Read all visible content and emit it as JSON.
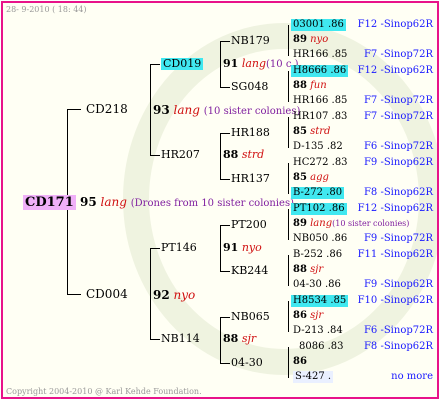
{
  "header": {
    "timestamp": "28-  9-2010 ( 18: 44)"
  },
  "footer": {
    "copyright": "Copyright 2004-2010 @ Karl Kehde Foundation."
  },
  "root": {
    "id": "CD171",
    "num": "95",
    "lang": "lang",
    "note": "(Drones from 10 sister colonies)"
  },
  "gen1": [
    {
      "id": "CD218",
      "num": "93",
      "lang": "lang",
      "note": "(10 sister colonies)"
    },
    {
      "id": "CD004",
      "num": "92",
      "lang": "nyo"
    }
  ],
  "gen2": [
    {
      "id": "CD019",
      "num": "91",
      "lang": "lang",
      "note": "(10 c.)"
    },
    {
      "id": "HR207",
      "num": "88",
      "lang": "strd"
    },
    {
      "id": "PT146",
      "num": "91",
      "lang": "nyo"
    },
    {
      "id": "NB114",
      "num": "88",
      "lang": "sjr"
    }
  ],
  "gen3": [
    "NB179",
    "SG048",
    "HR188",
    "HR137",
    "PT200",
    "KB244",
    "NB065",
    "04-30"
  ],
  "gen4": [
    {
      "id": "03001 .86",
      "num": "89",
      "lang": "nyo",
      "dam": "HR166 .85"
    },
    {
      "id": "H8666 .86",
      "num": "88",
      "lang": "fun",
      "dam": "HR166 .85"
    },
    {
      "id": "HR107 .83",
      "num": "85",
      "lang": "strd",
      "dam": "D-135 .82"
    },
    {
      "id": "HC272 .83",
      "num": "85",
      "lang": "agg",
      "dam": "B-272 .80"
    },
    {
      "id": "PT102 .86",
      "num": "89",
      "lang": "lang",
      "note": "(10 sister colonies)",
      "dam": "NB050 .86"
    },
    {
      "id": "B-252 .86",
      "num": "88",
      "lang": "sjr",
      "dam": "04-30 .86"
    },
    {
      "id": "H8534 .85",
      "num": "86",
      "lang": "sjr",
      "dam": "D-213 .84"
    },
    {
      "id": "8086 .83",
      "num": "86",
      "lang": "",
      "dam": "S-427 ."
    }
  ],
  "right_labels": [
    "F12 -Sinop62R",
    "F7 -Sinop72R",
    "F12 -Sinop62R",
    "F7 -Sinop72R",
    "F7 -Sinop72R",
    "F6 -Sinop72R",
    "F9 -Sinop62R",
    "F8 -Sinop62R",
    "F12 -Sinop62R",
    "F9 -Sinop72R",
    "F11 -Sinop62R",
    "F9 -Sinop62R",
    "F10 -Sinop62R",
    "F6 -Sinop72R",
    "F8 -Sinop62R",
    "no more"
  ]
}
